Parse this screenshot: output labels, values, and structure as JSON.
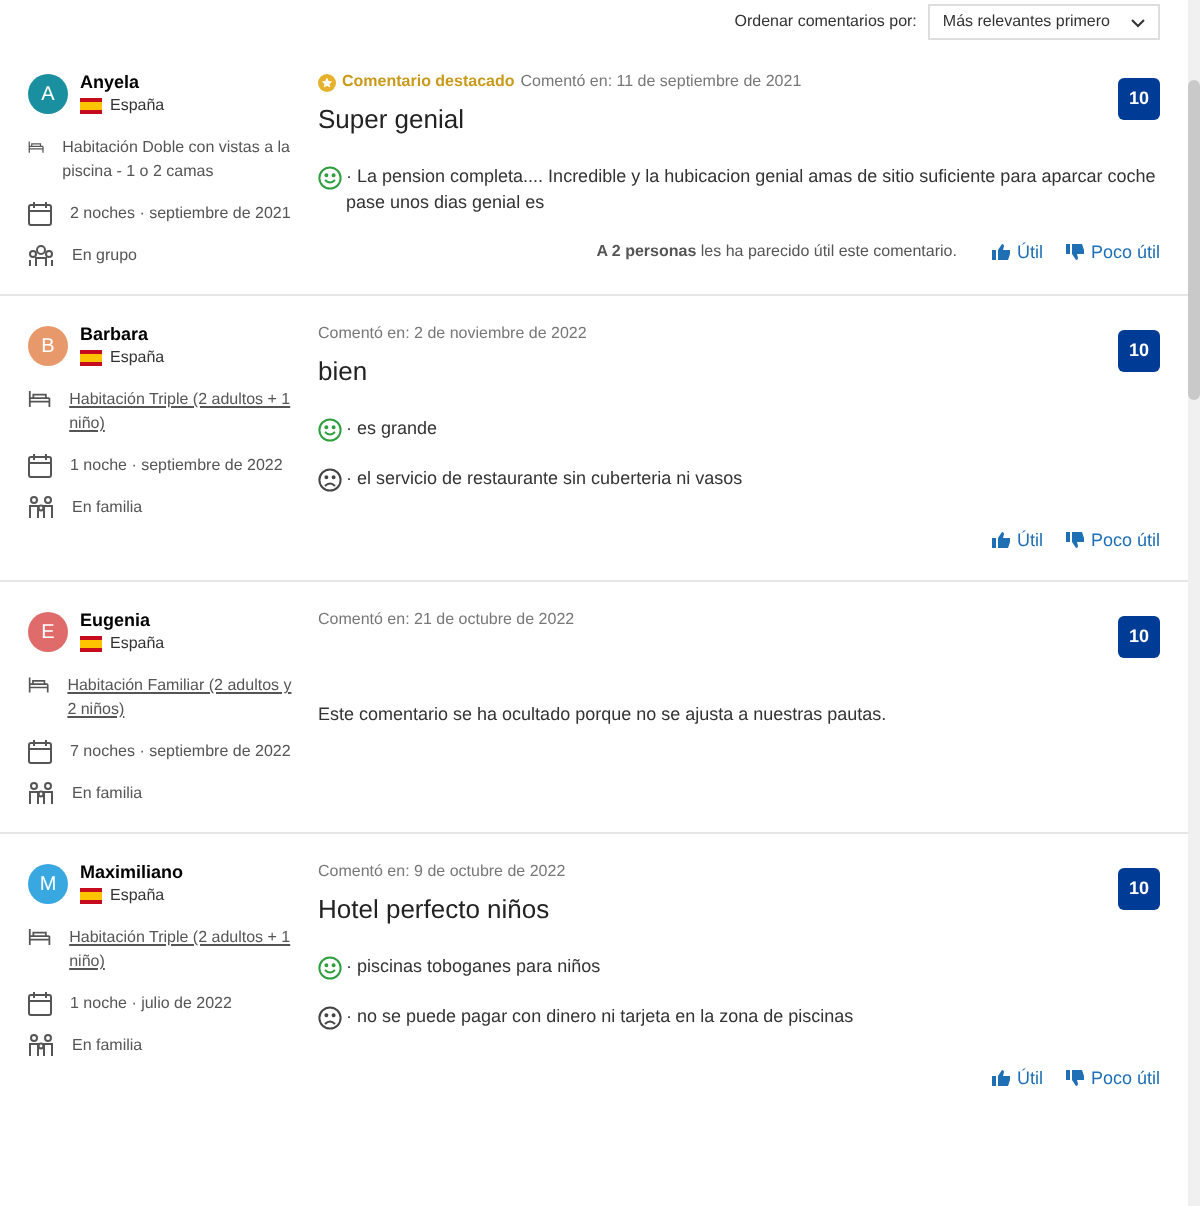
{
  "sort": {
    "label": "Ordenar comentarios por:",
    "value": "Más relevantes primero"
  },
  "reviews": [
    {
      "initial": "A",
      "color": "#1a8fa0",
      "name": "Anyela",
      "country": "España",
      "room": "Habitación Doble con vistas a la piscina - 1 o 2 camas",
      "room_link": false,
      "stay": "2 noches ·  septiembre de 2021",
      "traveller": {
        "kind": "group",
        "text": "En grupo"
      },
      "featured": "Comentario destacado",
      "date": "Comentó en: 11 de septiembre de 2021",
      "title": "Super genial",
      "comments": [
        {
          "kind": "positive",
          "text": "· La pension completa.... Incredible y la hubicacion genial amas de sitio suficiente para aparcar coche pase unos dias genial es"
        }
      ],
      "helpful": "**A 2 personas** les ha parecido útil este comentario.",
      "score": "10",
      "actions": [
        "Útil",
        "Poco útil"
      ]
    },
    {
      "initial": "B",
      "color": "#e8996b",
      "name": "Barbara",
      "country": "España",
      "room": "Habitación Triple (2 adultos + 1 niño)",
      "room_link": true,
      "stay": "1 noche ·  septiembre de 2022",
      "traveller": {
        "kind": "family",
        "text": "En familia"
      },
      "date": "Comentó en: 2 de noviembre de 2022",
      "title": "bien",
      "comments": [
        {
          "kind": "positive",
          "text": "· es grande"
        },
        {
          "kind": "negative",
          "text": "· el servicio de restaurante sin cuberteria ni vasos"
        }
      ],
      "score": "10",
      "actions": [
        "Útil",
        "Poco útil"
      ]
    },
    {
      "initial": "E",
      "color": "#e06b6b",
      "name": "Eugenia",
      "country": "España",
      "room": "Habitación Familiar (2 adultos y 2 niños)",
      "room_link": true,
      "stay": "7 noches ·  septiembre de 2022",
      "traveller": {
        "kind": "family",
        "text": "En familia"
      },
      "date": "Comentó en: 21 de octubre de 2022",
      "notice": "Este comentario se ha ocultado porque no se ajusta a nuestras pautas.",
      "score": "10"
    },
    {
      "initial": "M",
      "color": "#3aa8e0",
      "name": "Maximiliano",
      "country": "España",
      "room": "Habitación Triple (2 adultos + 1 niño)",
      "room_link": true,
      "stay": "1 noche ·  julio de 2022",
      "traveller": {
        "kind": "family",
        "text": "En familia"
      },
      "date": "Comentó en: 9 de octubre de 2022",
      "title": "Hotel perfecto niños",
      "comments": [
        {
          "kind": "positive",
          "text": "· piscinas toboganes para niños"
        },
        {
          "kind": "negative",
          "text": "· no se puede pagar con dinero ni tarjeta en la zona de piscinas"
        }
      ],
      "score": "10",
      "actions": [
        "Útil",
        "Poco útil"
      ]
    }
  ]
}
